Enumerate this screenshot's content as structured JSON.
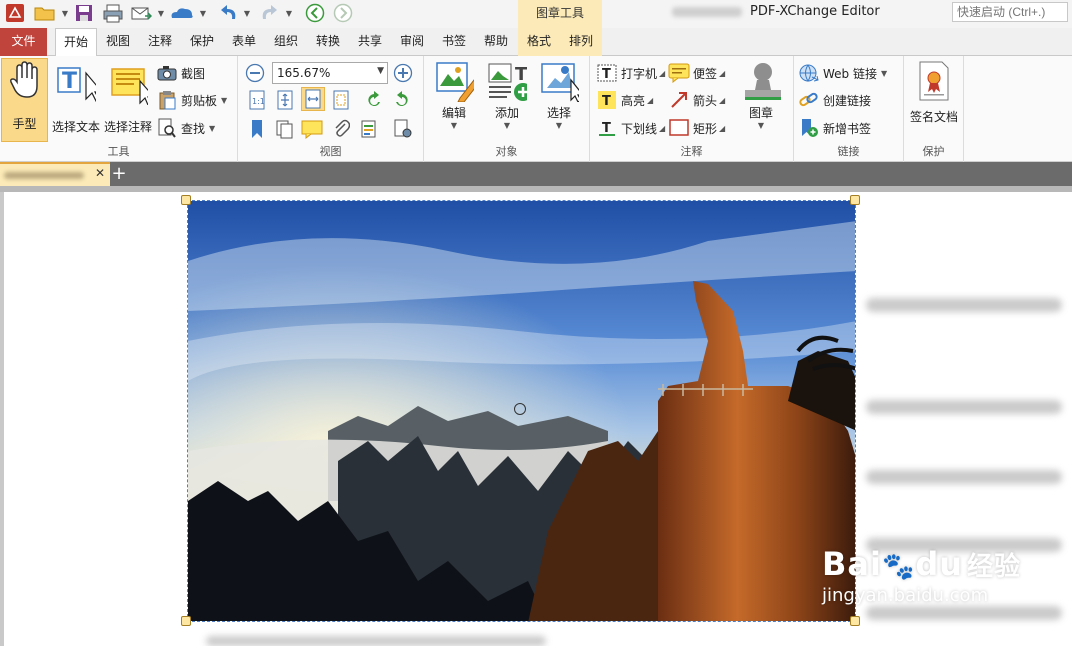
{
  "titlebar": {
    "context_group": "图章工具",
    "app_title": "PDF-XChange Editor",
    "quick_launch_placeholder": "快速启动 (Ctrl+.)"
  },
  "tabs": [
    "文件",
    "开始",
    "视图",
    "注释",
    "保护",
    "表单",
    "组织",
    "转换",
    "共享",
    "审阅",
    "书签",
    "帮助",
    "格式",
    "排列"
  ],
  "active_tab": "开始",
  "ribbon": {
    "tools": {
      "label": "工具",
      "hand": "手型",
      "select_text": "选择文本",
      "select_annot": "选择注释",
      "snapshot": "截图",
      "clipboard": "剪贴板",
      "find": "查找"
    },
    "view": {
      "label": "视图",
      "zoom": "165.67%"
    },
    "objects": {
      "label": "对象",
      "edit": "编辑",
      "add": "添加",
      "select": "选择"
    },
    "comment": {
      "label": "注释",
      "typewriter": "打字机",
      "note": "便签",
      "highlight": "高亮",
      "arrow": "箭头",
      "underline": "下划线",
      "rectangle": "矩形",
      "stamp": "图章"
    },
    "links": {
      "label": "链接",
      "web_links": "Web 链接",
      "create_link": "创建链接",
      "new_bookmark": "新增书签"
    },
    "protect": {
      "label": "保护",
      "sign": "签名文档"
    }
  },
  "watermark": {
    "brand_a": "Bai",
    "brand_b": "du",
    "brand_cn": "经验",
    "url": "jingyan.baidu.com"
  },
  "colors": {
    "file_tab": "#c0443c",
    "context_tab": "#fcebb8",
    "active_button": "#fbd98a",
    "doc_tab_strip": "#6b6b6b"
  }
}
